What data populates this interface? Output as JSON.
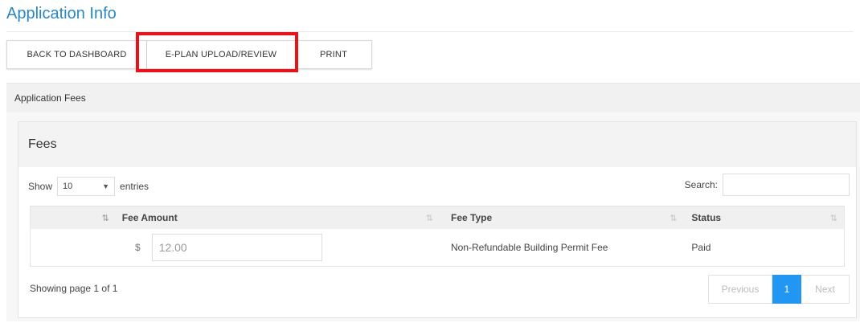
{
  "page": {
    "title": "Application Info"
  },
  "toolbar": {
    "back_label": "BACK TO DASHBOARD",
    "eplan_label": "E-PLAN UPLOAD/REVIEW",
    "print_label": "PRINT"
  },
  "annotation": {
    "highlight_color": "#e8121a"
  },
  "fees_panel": {
    "header": "Application Fees",
    "card_title": "Fees",
    "show_label": "Show",
    "entries_value": "10",
    "entries_label": "entries",
    "search_label": "Search:",
    "search_value": "",
    "columns": [
      "Fee Amount",
      "Fee Type",
      "Status"
    ],
    "rows": [
      {
        "currency": "$",
        "amount": "12.00",
        "fee_type": "Non-Refundable Building Permit Fee",
        "status": "Paid"
      }
    ],
    "info": "Showing page 1 of 1",
    "pager": {
      "previous": "Previous",
      "current": "1",
      "next": "Next"
    }
  },
  "colors": {
    "title": "#2a86c4",
    "active_page": "#2196f3"
  }
}
